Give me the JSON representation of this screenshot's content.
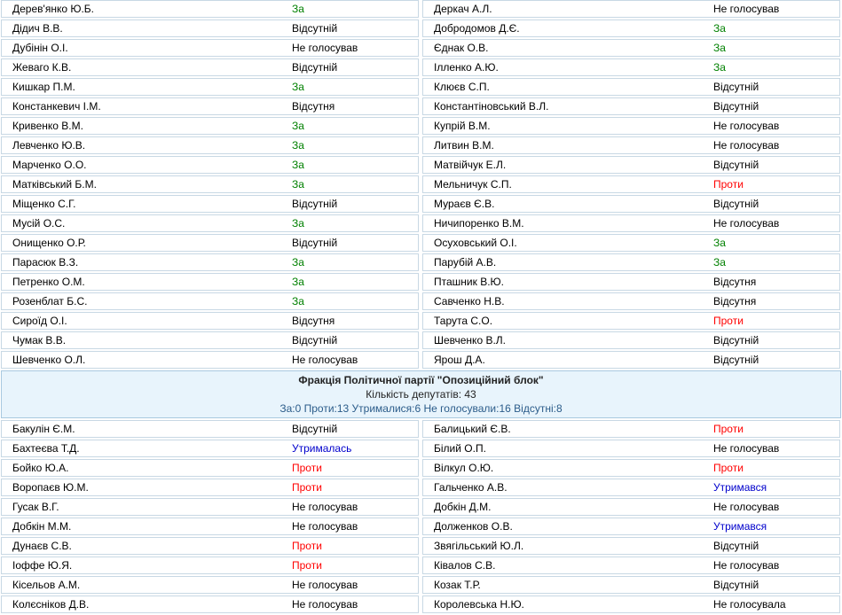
{
  "top_left": [
    {
      "name": "Дерев'янко Ю.Б.",
      "vote": "За",
      "kind": "za"
    },
    {
      "name": "Дідич В.В.",
      "vote": "Відсутній",
      "kind": "none"
    },
    {
      "name": "Дубінін О.І.",
      "vote": "Не голосував",
      "kind": "none"
    },
    {
      "name": "Жеваго К.В.",
      "vote": "Відсутній",
      "kind": "none"
    },
    {
      "name": "Кишкар П.М.",
      "vote": "За",
      "kind": "za"
    },
    {
      "name": "Констанкевич І.М.",
      "vote": "Відсутня",
      "kind": "none"
    },
    {
      "name": "Кривенко В.М.",
      "vote": "За",
      "kind": "za"
    },
    {
      "name": "Левченко Ю.В.",
      "vote": "За",
      "kind": "za"
    },
    {
      "name": "Марченко О.О.",
      "vote": "За",
      "kind": "za"
    },
    {
      "name": "Матківський Б.М.",
      "vote": "За",
      "kind": "za"
    },
    {
      "name": "Міщенко С.Г.",
      "vote": "Відсутній",
      "kind": "none"
    },
    {
      "name": "Мусій О.С.",
      "vote": "За",
      "kind": "za"
    },
    {
      "name": "Онищенко О.Р.",
      "vote": "Відсутній",
      "kind": "none"
    },
    {
      "name": "Парасюк В.З.",
      "vote": "За",
      "kind": "za"
    },
    {
      "name": "Петренко О.М.",
      "vote": "За",
      "kind": "za"
    },
    {
      "name": "Розенблат Б.С.",
      "vote": "За",
      "kind": "za"
    },
    {
      "name": "Сироїд О.І.",
      "vote": "Відсутня",
      "kind": "none"
    },
    {
      "name": "Чумак В.В.",
      "vote": "Відсутній",
      "kind": "none"
    },
    {
      "name": "Шевченко О.Л.",
      "vote": "Не голосував",
      "kind": "none"
    }
  ],
  "top_right": [
    {
      "name": "Деркач А.Л.",
      "vote": "Не голосував",
      "kind": "none"
    },
    {
      "name": "Добродомов Д.Є.",
      "vote": "За",
      "kind": "za"
    },
    {
      "name": "Єднак О.В.",
      "vote": "За",
      "kind": "za"
    },
    {
      "name": "Ілленко А.Ю.",
      "vote": "За",
      "kind": "za"
    },
    {
      "name": "Клюєв С.П.",
      "vote": "Відсутній",
      "kind": "none"
    },
    {
      "name": "Константіновський В.Л.",
      "vote": "Відсутній",
      "kind": "none"
    },
    {
      "name": "Купрій В.М.",
      "vote": "Не голосував",
      "kind": "none"
    },
    {
      "name": "Литвин В.М.",
      "vote": "Не голосував",
      "kind": "none"
    },
    {
      "name": "Матвійчук Е.Л.",
      "vote": "Відсутній",
      "kind": "none"
    },
    {
      "name": "Мельничук С.П.",
      "vote": "Проти",
      "kind": "proty"
    },
    {
      "name": "Мураєв Є.В.",
      "vote": "Відсутній",
      "kind": "none"
    },
    {
      "name": "Ничипоренко В.М.",
      "vote": "Не голосував",
      "kind": "none"
    },
    {
      "name": "Осуховський О.І.",
      "vote": "За",
      "kind": "za"
    },
    {
      "name": "Парубій А.В.",
      "vote": "За",
      "kind": "za"
    },
    {
      "name": "Пташник В.Ю.",
      "vote": "Відсутня",
      "kind": "none"
    },
    {
      "name": "Савченко Н.В.",
      "vote": "Відсутня",
      "kind": "none"
    },
    {
      "name": "Тарута С.О.",
      "vote": "Проти",
      "kind": "proty"
    },
    {
      "name": "Шевченко В.Л.",
      "vote": "Відсутній",
      "kind": "none"
    },
    {
      "name": "Ярош Д.А.",
      "vote": "Відсутній",
      "kind": "none"
    }
  ],
  "faction": {
    "title": "Фракція Політичної партії \"Опозиційний блок\"",
    "count": "Кількість депутатів: 43",
    "stats": "За:0 Проти:13 Утрималися:6 Не голосували:16 Відсутні:8"
  },
  "bottom_left": [
    {
      "name": "Бакулін Є.М.",
      "vote": "Відсутній",
      "kind": "none"
    },
    {
      "name": "Бахтеєва Т.Д.",
      "vote": "Утрималась",
      "kind": "utr"
    },
    {
      "name": "Бойко Ю.А.",
      "vote": "Проти",
      "kind": "proty"
    },
    {
      "name": "Воропаєв Ю.М.",
      "vote": "Проти",
      "kind": "proty"
    },
    {
      "name": "Гусак В.Г.",
      "vote": "Не голосував",
      "kind": "none"
    },
    {
      "name": "Добкін М.М.",
      "vote": "Не голосував",
      "kind": "none"
    },
    {
      "name": "Дунаєв С.В.",
      "vote": "Проти",
      "kind": "proty"
    },
    {
      "name": "Іоффе Ю.Я.",
      "vote": "Проти",
      "kind": "proty"
    },
    {
      "name": "Кісельов А.М.",
      "vote": "Не голосував",
      "kind": "none"
    },
    {
      "name": "Колєсніков Д.В.",
      "vote": "Не голосував",
      "kind": "none"
    }
  ],
  "bottom_right": [
    {
      "name": "Балицький Є.В.",
      "vote": "Проти",
      "kind": "proty"
    },
    {
      "name": "Білий О.П.",
      "vote": "Не голосував",
      "kind": "none"
    },
    {
      "name": "Вілкул О.Ю.",
      "vote": "Проти",
      "kind": "proty"
    },
    {
      "name": "Гальченко А.В.",
      "vote": "Утримався",
      "kind": "utr"
    },
    {
      "name": "Добкін Д.М.",
      "vote": "Не голосував",
      "kind": "none"
    },
    {
      "name": "Долженков О.В.",
      "vote": "Утримався",
      "kind": "utr"
    },
    {
      "name": "Звягільський Ю.Л.",
      "vote": "Відсутній",
      "kind": "none"
    },
    {
      "name": "Ківалов С.В.",
      "vote": "Не голосував",
      "kind": "none"
    },
    {
      "name": "Козак Т.Р.",
      "vote": "Відсутній",
      "kind": "none"
    },
    {
      "name": "Королевська Н.Ю.",
      "vote": "Не голосувала",
      "kind": "none"
    }
  ]
}
